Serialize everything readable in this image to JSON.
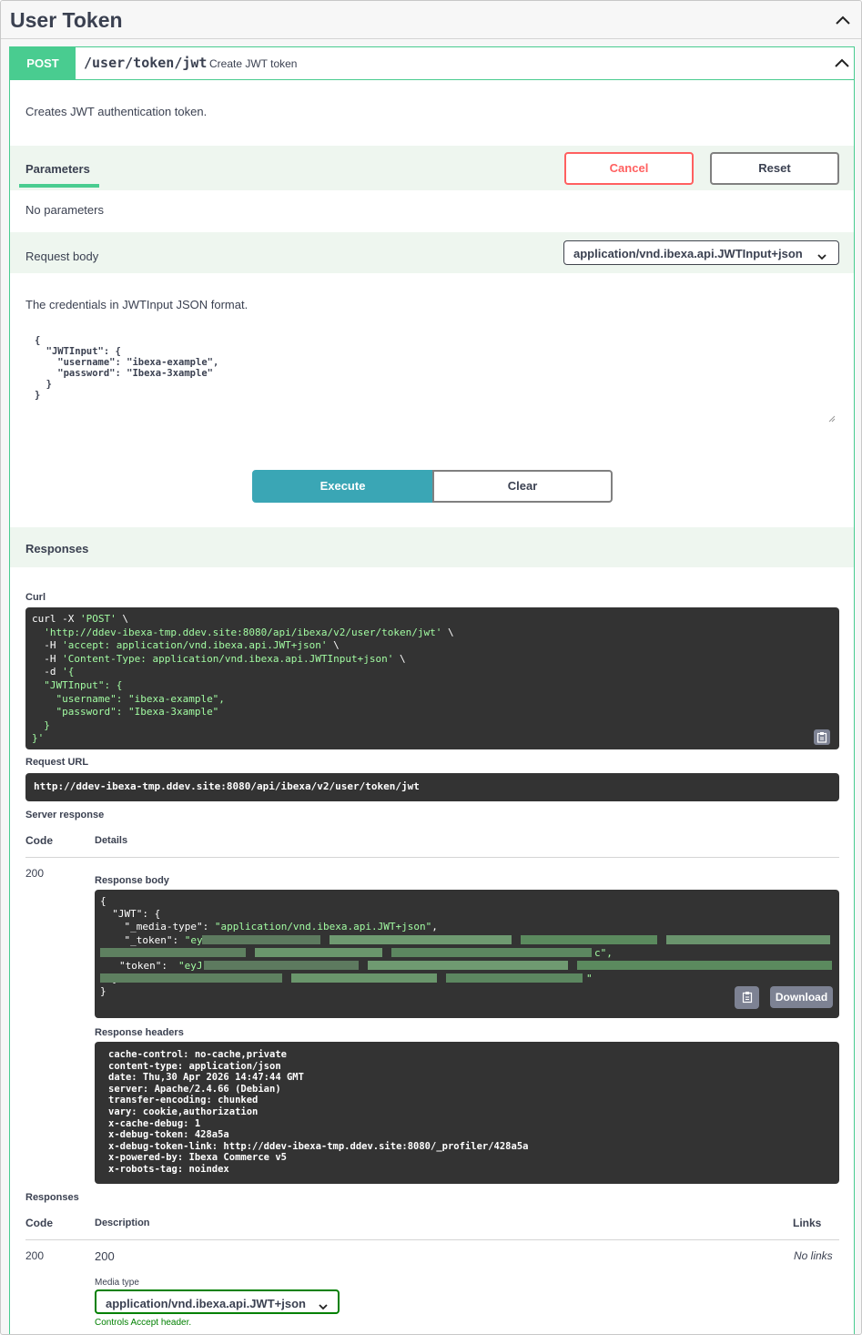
{
  "tag": {
    "title": "User Token"
  },
  "operation": {
    "method": "POST",
    "path": "/user/token/jwt",
    "summary": "Create JWT token",
    "description": "Creates JWT authentication token."
  },
  "parameters": {
    "tab_label": "Parameters",
    "cancel_label": "Cancel",
    "reset_label": "Reset",
    "empty_text": "No parameters"
  },
  "request_body": {
    "label": "Request body",
    "content_type": "application/vnd.ibexa.api.JWTInput+json",
    "description": "The credentials in JWTInput JSON format.",
    "example": "{\n  \"JWTInput\": {\n    \"username\": \"ibexa-example\",\n    \"password\": \"Ibexa-3xample\"\n  }\n}"
  },
  "actions": {
    "execute_label": "Execute",
    "clear_label": "Clear"
  },
  "responses_section": {
    "title": "Responses"
  },
  "curl": {
    "label": "Curl",
    "line1": "curl -X ",
    "method": "'POST'",
    "line1_end": " \\",
    "url": "'http://ddev-ibexa-tmp.ddev.site:8080/api/ibexa/v2/user/token/jwt'",
    "h1_prefix": "-H ",
    "h1": "'accept: application/vnd.ibexa.api.JWT+json'",
    "h2": "'Content-Type: application/vnd.ibexa.api.JWTInput+json'",
    "d_prefix": "-d ",
    "d_open": "'{",
    "body_key": "\"JWTInput\": {",
    "username_line": "\"username\": \"ibexa-example\",",
    "password_line": "\"password\": \"Ibexa-3xample\"",
    "close1": "}",
    "close2": "}'"
  },
  "request_url": {
    "label": "Request URL",
    "value": "http://ddev-ibexa-tmp.ddev.site:8080/api/ibexa/v2/user/token/jwt"
  },
  "server_response": {
    "label": "Server response",
    "code_header": "Code",
    "details_header": "Details",
    "code": "200",
    "body_label": "Response body",
    "body_open": "{",
    "jwt_key": "\"JWT\": {",
    "media_key": "\"_media-type\": ",
    "media_val": "\"application/vnd.ibexa.api.JWT+json\"",
    "token_key1": "\"_token\": ",
    "token_start1": "\"ey",
    "token_end1": "c\",",
    "token_key2": "\"token\": ",
    "token_start2": "\"eyJ",
    "token_end2": "\"",
    "jwt_close": "}",
    "body_close": "}",
    "download_label": "Download",
    "headers_label": "Response headers",
    "headers": [
      "cache-control: no-cache,private",
      "content-type: application/json",
      "date: Thu,30 Apr 2026 14:47:44 GMT",
      "server: Apache/2.4.66 (Debian)",
      "transfer-encoding: chunked",
      "vary: cookie,authorization",
      "x-cache-debug: 1",
      "x-debug-token: 428a5a",
      "x-debug-token-link: http://ddev-ibexa-tmp.ddev.site:8080/_profiler/428a5a",
      "x-powered-by: Ibexa Commerce v5",
      "x-robots-tag: noindex"
    ]
  },
  "documented_responses": {
    "label": "Responses",
    "code_header": "Code",
    "description_header": "Description",
    "links_header": "Links",
    "code": "200",
    "description": "200",
    "links": "No links",
    "media_type_label": "Media type",
    "media_type": "application/vnd.ibexa.api.JWT+json",
    "controls_accept": "Controls Accept header."
  },
  "colors": {
    "post_green": "#49cc90",
    "execute_teal": "#3aa6b5",
    "cancel_red": "#ff6060",
    "string_green": "#a2fca2",
    "code_bg": "#333333"
  }
}
